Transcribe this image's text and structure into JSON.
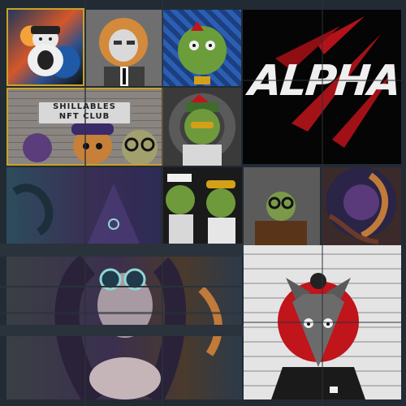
{
  "board": {
    "tiles": [
      {
        "name": "tile-nft-swirl-bear"
      },
      {
        "name": "tile-nft-suited-lion"
      },
      {
        "name": "tile-nft-mosaic-frog"
      },
      {
        "name": "tile-alpha-banner"
      },
      {
        "name": "tile-shillables-club"
      },
      {
        "name": "tile-nft-sergeant-frog"
      },
      {
        "name": "tile-nft-tentacle-dark"
      },
      {
        "name": "tile-nft-frog-pair"
      },
      {
        "name": "tile-nft-glasses-frog"
      },
      {
        "name": "tile-nft-purple-squid"
      },
      {
        "name": "tile-nft-goggles-girl"
      },
      {
        "name": "tile-nft-wolf-brickwall"
      }
    ]
  },
  "shillables": {
    "line1": "SHILLABLES",
    "line2": "NFT CLUB"
  },
  "alpha": {
    "text": "ALPHA"
  },
  "colors": {
    "background": "#1f2730",
    "accent_gold": "#c9a227",
    "accent_red": "#c0151b"
  }
}
